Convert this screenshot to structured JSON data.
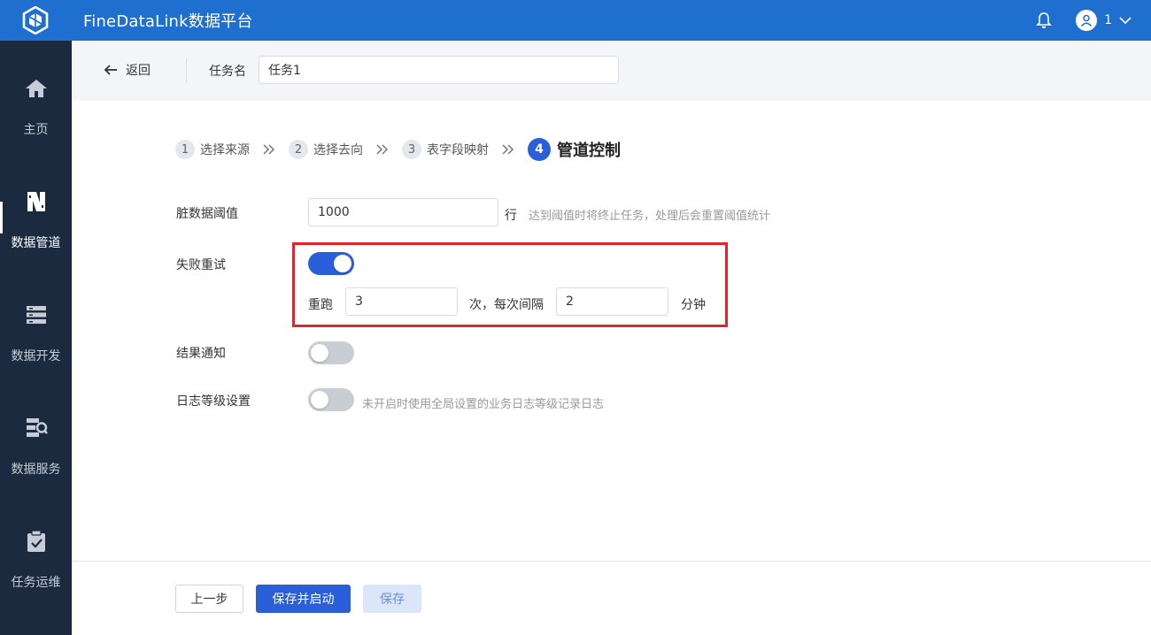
{
  "app": {
    "title": "FineDataLink数据平台",
    "user": "1"
  },
  "sidebar": {
    "items": [
      {
        "label": "主页",
        "icon": "home-icon",
        "active": false
      },
      {
        "label": "数据管道",
        "icon": "pipeline-icon",
        "active": true
      },
      {
        "label": "数据开发",
        "icon": "data-dev-icon",
        "active": false
      },
      {
        "label": "数据服务",
        "icon": "data-service-icon",
        "active": false
      },
      {
        "label": "任务运维",
        "icon": "task-ops-icon",
        "active": false
      }
    ]
  },
  "header": {
    "back_label": "返回",
    "task_name_label": "任务名",
    "task_name_value": "任务1"
  },
  "steps": [
    {
      "num": "1",
      "label": "选择来源"
    },
    {
      "num": "2",
      "label": "选择去向"
    },
    {
      "num": "3",
      "label": "表字段映射"
    },
    {
      "num": "4",
      "label": "管道控制"
    }
  ],
  "form": {
    "dirty": {
      "label": "脏数据阈值",
      "value": "1000",
      "unit": "行",
      "hint": "达到阈值时将终止任务，处理后会重置阈值统计"
    },
    "retry": {
      "label": "失败重试",
      "enabled": true,
      "rerun_label": "重跑",
      "times_value": "3",
      "times_unit": "次，每次间隔",
      "interval_value": "2",
      "interval_unit": "分钟"
    },
    "notify": {
      "label": "结果通知",
      "enabled": false
    },
    "log": {
      "label": "日志等级设置",
      "enabled": false,
      "hint": "未开启时使用全局设置的业务日志等级记录日志"
    }
  },
  "footer": {
    "prev_label": "上一步",
    "save_start_label": "保存并启动",
    "save_label": "保存"
  },
  "colors": {
    "topbar": "#1e6fd0",
    "sidebar": "#1b2a3f",
    "primary": "#2b5fd9",
    "highlight": "#e2242b"
  }
}
